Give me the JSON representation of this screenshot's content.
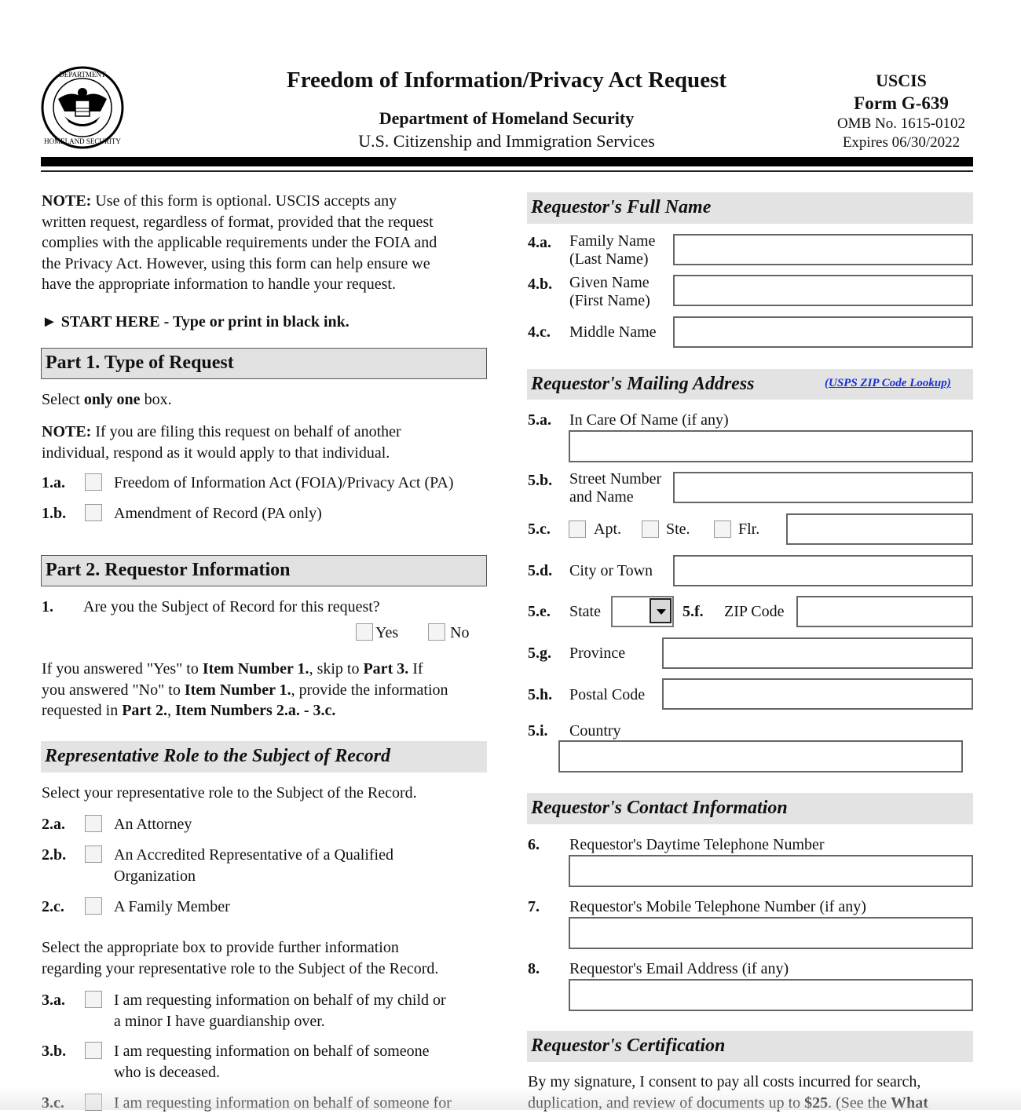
{
  "header": {
    "seal_label": "U.S. Department of Homeland Security seal",
    "title": "Freedom of Information/Privacy Act Request",
    "department": "Department of Homeland Security",
    "agency": "U.S. Citizenship and Immigration Services",
    "agency_short": "USCIS",
    "form_number": "Form G-639",
    "omb": "OMB No. 1615-0102",
    "expires": "Expires 06/30/2022"
  },
  "intro": {
    "note_label": "NOTE:",
    "note_lines": [
      " Use of this form is optional.  USCIS accepts any",
      "written request, regardless of format, provided that the request",
      "complies with the applicable requirements under the FOIA and",
      "the Privacy Act.  However, using this form can help ensure we",
      "have the appropriate information to handle your request."
    ],
    "start_here": "► START HERE - Type or print in black ink."
  },
  "part1": {
    "title": "Part 1.  Type of Request",
    "select_pre": "Select ",
    "select_bold": "only one",
    "select_post": " box.",
    "note_label": "NOTE:",
    "note_line1": "  If you are filing this request on behalf of another",
    "note_line2": "individual, respond as it would apply to that individual.",
    "items": [
      {
        "num": "1.a.",
        "label": "Freedom of Information Act (FOIA)/Privacy Act (PA)",
        "checked": false
      },
      {
        "num": "1.b.",
        "label": "Amendment of Record (PA only)",
        "checked": false
      }
    ]
  },
  "part2": {
    "title": "Part 2.  Requestor Information",
    "q1_num": "1.",
    "q1_text": "Are you the Subject of Record for this request?",
    "yes_label": "Yes",
    "no_label": "No",
    "instr": {
      "a": "If you answered \"Yes\" to ",
      "b": "Item Number 1.",
      "c": ", skip to ",
      "d": "Part 3.",
      "e": "  If",
      "f": "you answered \"No\" to ",
      "g": "Item Number 1.",
      "h": ", provide the information",
      "i": "requested in ",
      "j": "Part 2.",
      "k": ", ",
      "l": "Item Numbers 2.a. - 3.c."
    },
    "rep_section_title": "Representative Role to the Subject of Record",
    "rep_select_text": "Select your representative role to the Subject of the Record.",
    "roles": [
      {
        "num": "2.a.",
        "line1": "An Attorney",
        "line2": ""
      },
      {
        "num": "2.b.",
        "line1": "An Accredited Representative of a Qualified",
        "line2": "Organization"
      },
      {
        "num": "2.c.",
        "line1": "A Family Member",
        "line2": ""
      }
    ],
    "further_line1": "Select the appropriate box to provide further information",
    "further_line2": "regarding your representative role to the Subject of the Record.",
    "further": [
      {
        "num": "3.a.",
        "line1": "I am requesting information on behalf of my child or",
        "line2": "a minor I have guardianship over."
      },
      {
        "num": "3.b.",
        "line1": "I am requesting information on behalf of someone",
        "line2": "who is deceased."
      },
      {
        "num": "3.c.",
        "line1": "I am requesting information on behalf of someone for",
        "line2": ""
      }
    ]
  },
  "full_name": {
    "title": "Requestor's Full Name",
    "fields": [
      {
        "num": "4.a.",
        "line1": "Family Name",
        "line2": "(Last Name)",
        "value": ""
      },
      {
        "num": "4.b.",
        "line1": "Given Name",
        "line2": "(First Name)",
        "value": ""
      },
      {
        "num": "4.c.",
        "line1": "Middle Name",
        "line2": "",
        "value": ""
      }
    ]
  },
  "mailing": {
    "title": "Requestor's Mailing Address",
    "zip_lookup_link": "(USPS ZIP Code Lookup)",
    "in_care_num": "5.a.",
    "in_care_label": "In Care Of Name (if any)",
    "street_num": "5.b.",
    "street_line1": "Street Number",
    "street_line2": "and Name",
    "unit_num": "5.c.",
    "apt_label": "Apt.",
    "ste_label": "Ste.",
    "flr_label": "Flr.",
    "city_num": "5.d.",
    "city_label": "City or Town",
    "state_num": "5.e.",
    "state_label": "State",
    "state_value": "",
    "zip_num": "5.f.",
    "zip_label": "ZIP Code",
    "province_num": "5.g.",
    "province_label": "Province",
    "postal_num": "5.h.",
    "postal_label": "Postal Code",
    "country_num": "5.i.",
    "country_label": "Country"
  },
  "contact": {
    "title": "Requestor's Contact Information",
    "items": [
      {
        "num": "6.",
        "label": "Requestor's Daytime Telephone Number"
      },
      {
        "num": "7.",
        "label": "Requestor's Mobile Telephone Number (if any)"
      },
      {
        "num": "8.",
        "label": "Requestor's Email Address (if any)"
      }
    ]
  },
  "certification": {
    "title": "Requestor's Certification",
    "line1": "By my signature, I consent to pay all costs incurred for search,",
    "line2_a": "duplication, and review of documents up to ",
    "line2_b": "$25",
    "line2_c": ".  (See the ",
    "line2_d": "What"
  }
}
